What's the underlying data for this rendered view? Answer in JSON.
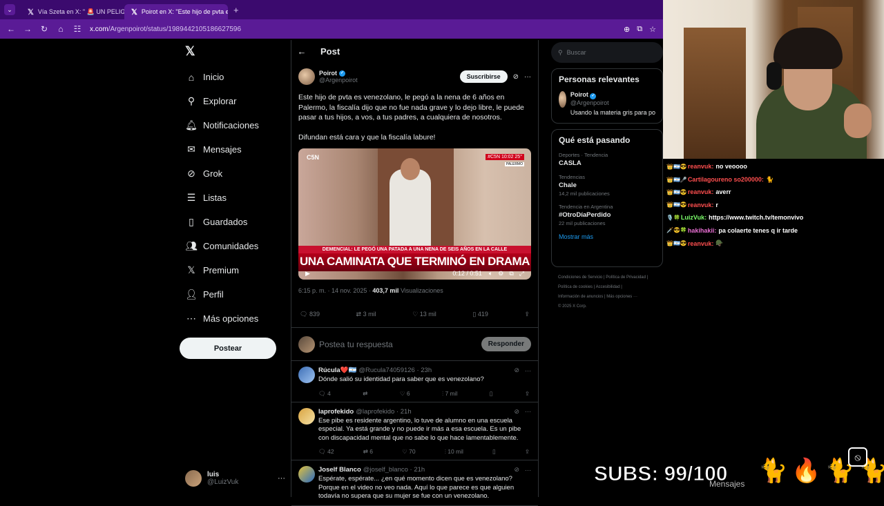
{
  "browser": {
    "tabs": [
      {
        "label": "Vía Szeta en X: \" 🚨 UN PELIGRO...",
        "active": false
      },
      {
        "label": "Poirot en X: \"Este hijo de pvta e...",
        "active": true
      }
    ],
    "url_host": "x.com",
    "url_path": "/Argenpoirot/status/1989442105186627596"
  },
  "nav": {
    "items": [
      {
        "icon": "home-icon",
        "label": "Inicio"
      },
      {
        "icon": "search-icon",
        "label": "Explorar"
      },
      {
        "icon": "bell-icon",
        "label": "Notificaciones"
      },
      {
        "icon": "mail-icon",
        "label": "Mensajes"
      },
      {
        "icon": "grok-icon",
        "label": "Grok"
      },
      {
        "icon": "list-icon",
        "label": "Listas"
      },
      {
        "icon": "bookmark-icon",
        "label": "Guardados"
      },
      {
        "icon": "people-icon",
        "label": "Comunidades"
      },
      {
        "icon": "x-icon",
        "label": "Premium"
      },
      {
        "icon": "person-icon",
        "label": "Perfil"
      },
      {
        "icon": "more-icon",
        "label": "Más opciones"
      }
    ],
    "post_button": "Postear",
    "account": {
      "name": "luis",
      "handle": "@LuizVuk"
    }
  },
  "main": {
    "title": "Post",
    "author": {
      "name": "Poirot",
      "handle": "@Argenpoirot"
    },
    "subscribe": "Suscribirse",
    "text1": "Este hijo de pvta es venezolano, le pegó a la nena de 6 años en Palermo, la fiscalía dijo que no fue nada grave y lo dejo libre, le puede pasar a tus hijos, a vos, a tus padres, a cualquiera de nosotros.",
    "text2": "Difundan está cara y que la fiscalía labure!",
    "video": {
      "channel": "C5N",
      "live_badge": "#C5N 10:02 25°",
      "location": "PALERMO",
      "ticker": "DEMENCIAL: LE PEGÓ UNA PATADA A UNA NENA DE SEIS AÑOS EN LA CALLE",
      "headline": "UNA CAMINATA QUE TERMINÓ EN DRAMA",
      "time": "0:12 / 0:51"
    },
    "meta_time": "6:15 p. m. · 14 nov. 2025 · ",
    "views_count": "403,7 mil",
    "views_label": " Visualizaciones",
    "stats": {
      "replies": "839",
      "reposts": "3 mil",
      "likes": "13 mil",
      "bookmarks": "419"
    },
    "reply_placeholder": "Postea tu respuesta",
    "reply_button": "Responder",
    "replies": [
      {
        "name": "Rúcula❤️🇦🇷",
        "handle": "@Rucula74059126 · 23h",
        "text": "Dónde salió su identidad para saber que es venezolano?",
        "replies": "4",
        "reposts": "",
        "likes": "6",
        "views": "7 mil"
      },
      {
        "name": "laprofekido",
        "handle": "@laprofekido · 21h",
        "text": "Ese pibe es residente argentino, lo tuve de alumno en una escuela especial. Ya está grande y no puede ir más a esa escuela. Es un pibe con discapacidad mental que no sabe lo que hace lamentablemente.",
        "replies": "42",
        "reposts": "6",
        "likes": "70",
        "views": "10 mil"
      },
      {
        "name": "Joself Blanco",
        "handle": "@joself_blanco · 21h",
        "text": "Espérate, espérate... ¿en qué momento dicen que es venezolano? Porque en el video no veo nada. Aquí lo que parece es que alguien todavía no supera que su mujer se fue con un venezolano."
      }
    ]
  },
  "right": {
    "search_placeholder": "Buscar",
    "relevant_title": "Personas relevantes",
    "relevant": {
      "name": "Poirot",
      "handle": "@Argenpoirot",
      "bio": "Usando la materia gris para po"
    },
    "trending_title": "Qué está pasando",
    "trends": [
      {
        "context": "Deportes · Tendencia",
        "name": "CASLA",
        "count": ""
      },
      {
        "context": "Tendencias",
        "name": "Chale",
        "count": "14,2 mil publicaciones"
      },
      {
        "context": "Tendencia en Argentina",
        "name": "#OtroDíaPerdido",
        "count": "22 mil publicaciones"
      }
    ],
    "show_more": "Mostrar más",
    "footer1": "Condiciones de Servicio | Política de Privacidad |",
    "footer2": "Política de cookies | Accesibilidad |",
    "footer3": "Información de anuncios | Más opciones ···",
    "footer4": "© 2025 X Corp."
  },
  "chat": [
    {
      "user": "reanvuk:",
      "text": "no veoooo",
      "color": "#ff4f4f",
      "badges": "👑🇦🇷😎"
    },
    {
      "user": "Cartilagoureno so200000:",
      "text": "🐈",
      "color": "#ff4f4f",
      "badges": "👑🇦🇷🎤"
    },
    {
      "user": "reanvuk:",
      "text": "averr",
      "color": "#ff4f4f",
      "badges": "👑🇦🇷😎"
    },
    {
      "user": "reanvuk:",
      "text": "r",
      "color": "#ff4f4f",
      "badges": "👑🇦🇷😎"
    },
    {
      "user": "LuizVuk:",
      "text": "https://www.twitch.tv/temonvivo",
      "color": "#7cff6b",
      "badges": "🎙️🍀"
    },
    {
      "user": "hakihakii:",
      "text": "pa colaerte tenes q ir tarde",
      "color": "#e86fd3",
      "badges": "🗡️😎🍀"
    },
    {
      "user": "reanvuk:",
      "text": "🪖",
      "color": "#ff4f4f",
      "badges": "👑🇦🇷😎"
    }
  ],
  "overlay": {
    "subs": "SUBS: 99/100",
    "mensajes": "Mensajes"
  }
}
